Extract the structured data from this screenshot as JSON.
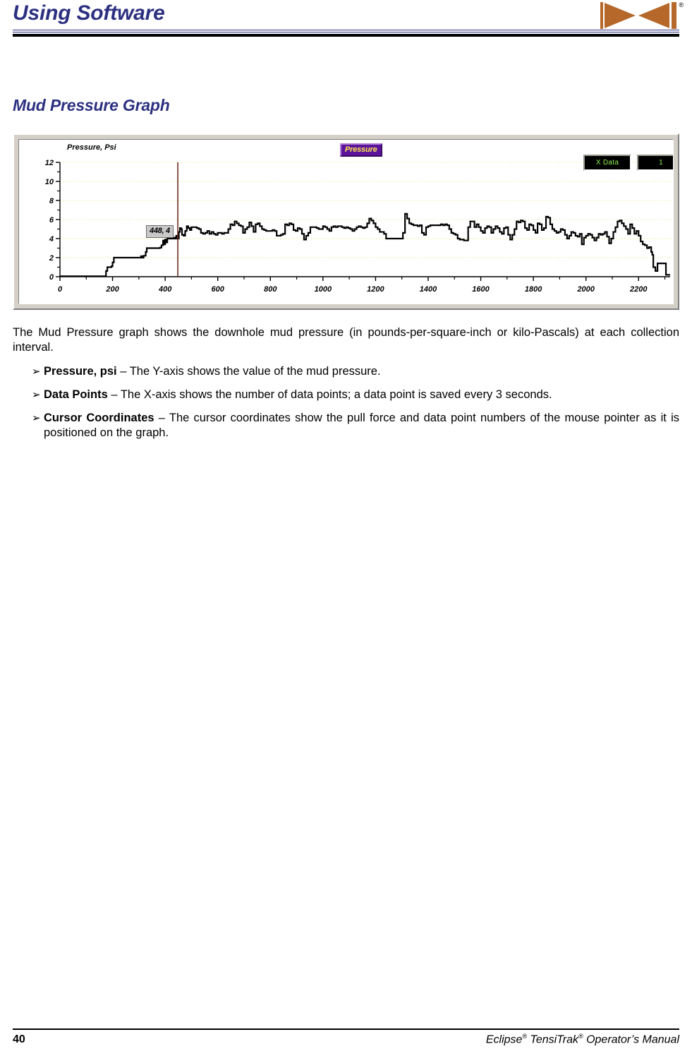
{
  "header": {
    "title": "Using Software",
    "logo_name": "dci-logo",
    "logo_registered": "®",
    "accent_color": "#2c3080"
  },
  "section": {
    "heading": "Mud Pressure Graph"
  },
  "chart_widget": {
    "legend_label": "Pressure",
    "legend_bg": "#5b149b",
    "legend_text_color": "#ffe94a",
    "readout_x_label": "X Data",
    "readout_value": "1",
    "readout_text_color": "#8ef050",
    "cursor_tooltip": "448, 4",
    "cursor_line_color": "#6b2f1f",
    "gridline_color": "#e8dc6a"
  },
  "chart_data": {
    "type": "line",
    "title": "",
    "subtitle": "",
    "xlabel": "",
    "ylabel": "Pressure, Psi",
    "xlim": [
      0,
      2320
    ],
    "ylim": [
      0,
      12
    ],
    "xticks": [
      0,
      200,
      400,
      600,
      800,
      1000,
      1200,
      1400,
      1600,
      1800,
      2000,
      2200
    ],
    "yticks": [
      0,
      2,
      4,
      6,
      8,
      10,
      12
    ],
    "yminorticks": [
      1,
      3,
      5,
      7,
      9,
      11
    ],
    "grid": true,
    "legend_position": "top-center",
    "series_name": "Pressure",
    "line_color": "#000000",
    "cursor_x": 448,
    "cursor_y": 4,
    "annotations": [
      "448, 4"
    ],
    "x": [
      0,
      60,
      120,
      170,
      175,
      180,
      190,
      196,
      200,
      205,
      208,
      212,
      240,
      270,
      300,
      308,
      312,
      318,
      322,
      326,
      330,
      334,
      360,
      380,
      386,
      392,
      396,
      400,
      404,
      408,
      412,
      418,
      424,
      430,
      436,
      442,
      448,
      452,
      456,
      460,
      464,
      470,
      476,
      482,
      488,
      494,
      500,
      506,
      512,
      520,
      528,
      536,
      544,
      552,
      560,
      568,
      576,
      584,
      592,
      600,
      608,
      616,
      624,
      632,
      640,
      648,
      656,
      664,
      672,
      680,
      688,
      696,
      704,
      712,
      720,
      728,
      736,
      744,
      752,
      760,
      768,
      776,
      784,
      792,
      800,
      808,
      816,
      824,
      832,
      840,
      848,
      856,
      864,
      872,
      880,
      888,
      896,
      904,
      912,
      920,
      928,
      936,
      944,
      952,
      960,
      968,
      976,
      984,
      992,
      1000,
      1008,
      1016,
      1024,
      1032,
      1040,
      1048,
      1056,
      1064,
      1072,
      1080,
      1088,
      1096,
      1104,
      1112,
      1120,
      1128,
      1136,
      1144,
      1152,
      1160,
      1168,
      1176,
      1184,
      1192,
      1200,
      1208,
      1216,
      1224,
      1232,
      1240,
      1248,
      1256,
      1264,
      1272,
      1280,
      1288,
      1296,
      1304,
      1312,
      1320,
      1328,
      1336,
      1344,
      1352,
      1360,
      1368,
      1376,
      1384,
      1392,
      1400,
      1408,
      1416,
      1424,
      1432,
      1440,
      1448,
      1456,
      1464,
      1472,
      1480,
      1488,
      1496,
      1504,
      1512,
      1520,
      1528,
      1536,
      1544,
      1552,
      1560,
      1568,
      1576,
      1584,
      1592,
      1600,
      1608,
      1616,
      1624,
      1632,
      1640,
      1648,
      1656,
      1664,
      1672,
      1680,
      1688,
      1696,
      1704,
      1712,
      1720,
      1728,
      1736,
      1744,
      1752,
      1760,
      1768,
      1776,
      1784,
      1792,
      1800,
      1808,
      1816,
      1824,
      1832,
      1840,
      1848,
      1856,
      1864,
      1872,
      1880,
      1888,
      1896,
      1904,
      1912,
      1920,
      1928,
      1936,
      1944,
      1952,
      1960,
      1968,
      1976,
      1984,
      1992,
      2000,
      2008,
      2016,
      2024,
      2032,
      2040,
      2048,
      2056,
      2064,
      2072,
      2080,
      2088,
      2096,
      2104,
      2112,
      2120,
      2128,
      2136,
      2144,
      2152,
      2160,
      2168,
      2176,
      2184,
      2192,
      2200,
      2208,
      2216,
      2224,
      2232,
      2240,
      2248,
      2252,
      2256,
      2264,
      2272,
      2280,
      2288,
      2296,
      2304,
      2312,
      2320
    ],
    "y": [
      0.05,
      0.05,
      0.05,
      0.05,
      0.6,
      1.0,
      1.0,
      1.1,
      1.5,
      2.0,
      2.0,
      2.0,
      2.0,
      2.0,
      2.0,
      2.15,
      2.0,
      2.2,
      2.2,
      2.6,
      3.0,
      3.0,
      3.0,
      3.05,
      3.3,
      3.8,
      3.4,
      3.9,
      3.6,
      4.0,
      4.0,
      4.0,
      4.0,
      4.1,
      4.0,
      4.3,
      4.0,
      4.7,
      5.1,
      5.0,
      4.4,
      4.3,
      4.8,
      5.3,
      5.1,
      4.9,
      5.2,
      5.2,
      5.2,
      5.1,
      5.0,
      4.6,
      4.5,
      4.6,
      4.8,
      4.5,
      4.7,
      4.5,
      4.4,
      4.6,
      4.6,
      4.5,
      4.6,
      4.6,
      5.0,
      5.5,
      5.4,
      5.8,
      5.6,
      5.4,
      5.3,
      4.6,
      5.0,
      5.2,
      5.7,
      5.3,
      4.7,
      5.5,
      5.6,
      5.3,
      5.0,
      4.9,
      4.8,
      4.8,
      4.8,
      4.9,
      4.8,
      4.3,
      4.3,
      4.4,
      4.5,
      5.5,
      5.4,
      5.6,
      5.5,
      4.9,
      4.8,
      5.1,
      5.0,
      4.5,
      3.9,
      4.3,
      4.6,
      5.2,
      5.2,
      5.2,
      5.1,
      5.0,
      5.0,
      5.3,
      5.2,
      5.0,
      4.8,
      5.2,
      5.3,
      5.2,
      5.3,
      5.3,
      5.2,
      5.1,
      5.2,
      5.1,
      5.0,
      4.8,
      5.0,
      5.2,
      5.3,
      5.2,
      5.1,
      5.2,
      5.6,
      6.1,
      5.9,
      5.6,
      5.2,
      5.0,
      4.7,
      4.7,
      4.5,
      4.0,
      4.0,
      4.0,
      4.0,
      4.0,
      4.0,
      4.0,
      4.0,
      4.6,
      6.6,
      6.1,
      5.6,
      5.5,
      5.4,
      5.4,
      5.3,
      5.4,
      4.6,
      4.4,
      5.2,
      5.3,
      5.4,
      5.4,
      5.4,
      5.4,
      5.4,
      5.5,
      5.4,
      5.5,
      5.4,
      5.0,
      4.6,
      4.5,
      4.4,
      4.0,
      3.9,
      3.9,
      3.8,
      3.8,
      5.2,
      5.8,
      5.8,
      5.2,
      5.5,
      5.2,
      4.8,
      4.6,
      5.1,
      5.3,
      5.2,
      4.6,
      5.0,
      5.3,
      5.1,
      4.7,
      4.5,
      5.1,
      5.2,
      4.4,
      3.9,
      4.4,
      5.0,
      5.8,
      5.7,
      5.9,
      5.8,
      5.1,
      4.9,
      5.5,
      5.4,
      4.9,
      4.6,
      5.6,
      5.5,
      4.9,
      5.1,
      6.3,
      6.2,
      5.5,
      5.0,
      4.8,
      4.6,
      4.7,
      5.0,
      4.9,
      4.4,
      4.0,
      4.3,
      4.7,
      4.6,
      4.3,
      4.2,
      4.5,
      3.4,
      4.1,
      4.3,
      4.5,
      4.4,
      4.1,
      3.8,
      4.1,
      4.5,
      4.4,
      4.5,
      4.7,
      4.2,
      3.5,
      4.0,
      4.7,
      5.2,
      5.8,
      5.9,
      5.6,
      5.3,
      5.0,
      4.5,
      5.5,
      5.1,
      4.5,
      4.8,
      4.3,
      3.7,
      3.4,
      3.3,
      3.0,
      3.1,
      2.6,
      2.3,
      1.0,
      0.6,
      1.4,
      1.4,
      1.4,
      1.4,
      0.2,
      0.2,
      0.2,
      0.2
    ]
  },
  "body": {
    "intro": "The Mud Pressure graph shows the downhole mud pressure (in pounds-per-square-inch or kilo-Pascals) at each collection interval.",
    "bullet_marker": "➢",
    "bullets": [
      {
        "term": "Pressure, psi",
        "text": " – The Y-axis shows the value of the mud pressure."
      },
      {
        "term": "Data Points",
        "text": " – The X-axis shows the number of data points; a data point is saved every 3 seconds."
      },
      {
        "term": "Cursor Coordinates",
        "text": " – The cursor coordinates show the pull force and data point numbers of the mouse pointer as it is positioned on the graph."
      }
    ]
  },
  "footer": {
    "page_number": "40",
    "manual_part1": "Eclipse",
    "manual_reg1": "®",
    "manual_part2": " TensiTrak",
    "manual_reg2": "®",
    "manual_part3": " Operator’s Manual"
  }
}
